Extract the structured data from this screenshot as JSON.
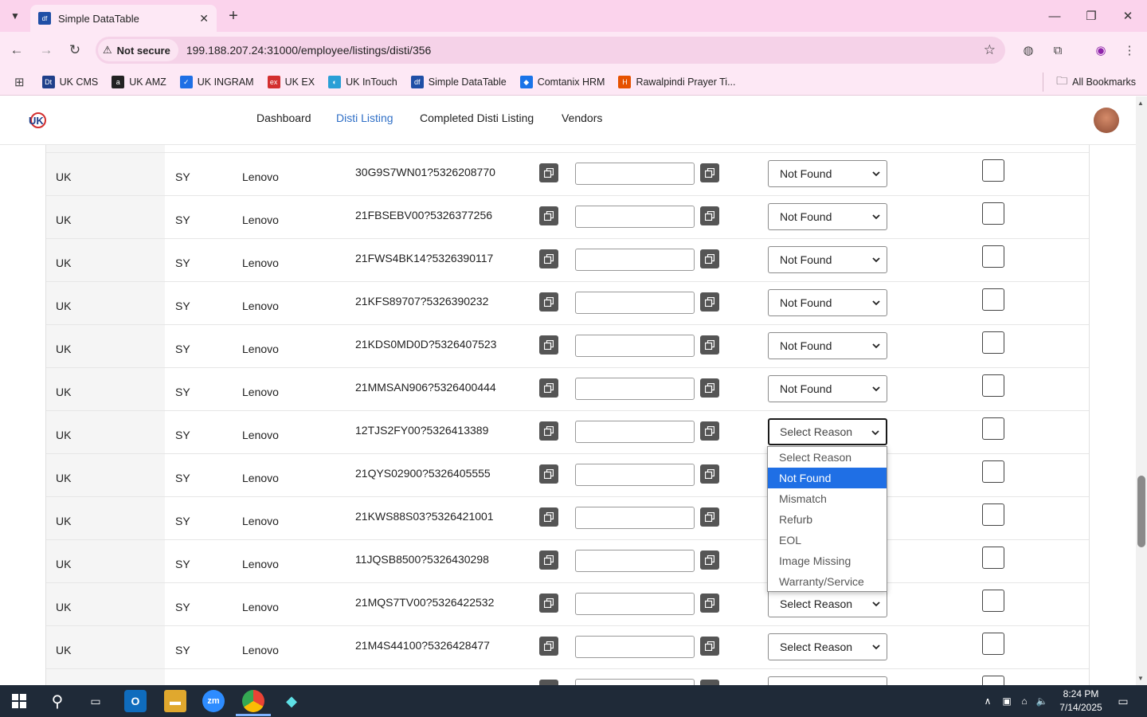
{
  "browser": {
    "tab_title": "Simple DataTable",
    "tab_favicon": "df",
    "url": "199.188.207.24:31000/employee/listings/disti/356",
    "security_label": "Not secure",
    "bookmarks": [
      {
        "label": "UK CMS",
        "color": "#1f3f8a",
        "icon": "Dt"
      },
      {
        "label": "UK AMZ",
        "color": "#222222",
        "icon": "a"
      },
      {
        "label": "UK INGRAM",
        "color": "#1f6fe5",
        "icon": "✓"
      },
      {
        "label": "UK EX",
        "color": "#d32f2f",
        "icon": "ex"
      },
      {
        "label": "UK InTouch",
        "color": "#2a9fd6",
        "icon": "◐"
      },
      {
        "label": "Simple DataTable",
        "color": "#1f4fa6",
        "icon": "df"
      },
      {
        "label": "Comtanix HRM",
        "color": "#1a73e8",
        "icon": "◆"
      },
      {
        "label": "Rawalpindi Prayer Ti...",
        "color": "#e65100",
        "icon": "H"
      }
    ],
    "all_bookmarks": "All Bookmarks"
  },
  "app": {
    "logo_text": "UK",
    "nav": [
      {
        "label": "Dashboard",
        "active": false
      },
      {
        "label": "Disti Listing",
        "active": true
      },
      {
        "label": "Completed Disti Listing",
        "active": false
      },
      {
        "label": "Vendors",
        "active": false
      }
    ]
  },
  "rows": [
    {
      "country": "UK",
      "code": "SY",
      "brand": "Lenovo",
      "sku": "30G9S7WN01?5326208770",
      "reason": "Not Found"
    },
    {
      "country": "UK",
      "code": "SY",
      "brand": "Lenovo",
      "sku": "21FBSEBV00?5326377256",
      "reason": "Not Found"
    },
    {
      "country": "UK",
      "code": "SY",
      "brand": "Lenovo",
      "sku": "21FWS4BK14?5326390117",
      "reason": "Not Found"
    },
    {
      "country": "UK",
      "code": "SY",
      "brand": "Lenovo",
      "sku": "21KFS89707?5326390232",
      "reason": "Not Found"
    },
    {
      "country": "UK",
      "code": "SY",
      "brand": "Lenovo",
      "sku": "21KDS0MD0D?5326407523",
      "reason": "Not Found"
    },
    {
      "country": "UK",
      "code": "SY",
      "brand": "Lenovo",
      "sku": "21MMSAN906?5326400444",
      "reason": "Not Found"
    },
    {
      "country": "UK",
      "code": "SY",
      "brand": "Lenovo",
      "sku": "12TJS2FY00?5326413389",
      "reason": "Select Reason"
    },
    {
      "country": "UK",
      "code": "SY",
      "brand": "Lenovo",
      "sku": "21QYS02900?5326405555",
      "reason": ""
    },
    {
      "country": "UK",
      "code": "SY",
      "brand": "Lenovo",
      "sku": "21KWS88S03?5326421001",
      "reason": ""
    },
    {
      "country": "UK",
      "code": "SY",
      "brand": "Lenovo",
      "sku": "11JQSB8500?5326430298",
      "reason": ""
    },
    {
      "country": "UK",
      "code": "SY",
      "brand": "Lenovo",
      "sku": "21MQS7TV00?5326422532",
      "reason": "Select Reason"
    },
    {
      "country": "UK",
      "code": "SY",
      "brand": "Lenovo",
      "sku": "21M4S44100?5326428477",
      "reason": "Select Reason"
    }
  ],
  "dropdown": {
    "options": [
      "Select Reason",
      "Not Found",
      "Mismatch",
      "Refurb",
      "EOL",
      "Image Missing",
      "Warranty/Service"
    ],
    "highlighted": "Not Found"
  },
  "taskbar": {
    "time": "8:24 PM",
    "date": "7/14/2025"
  }
}
